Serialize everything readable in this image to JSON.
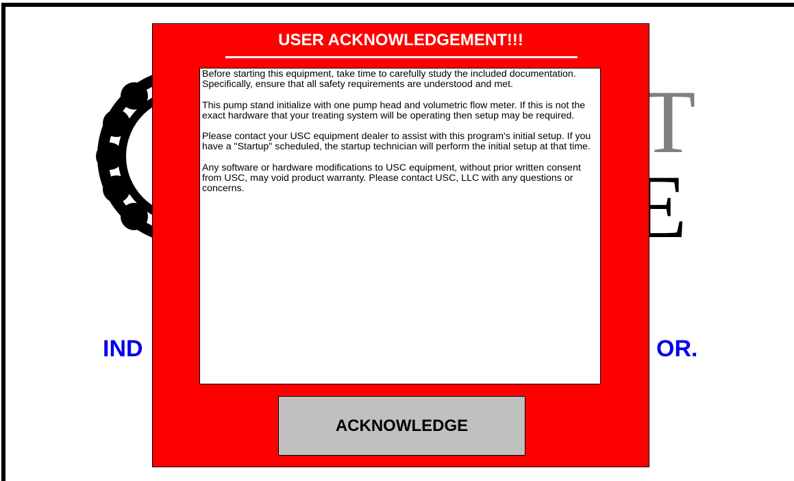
{
  "background": {
    "logo_letter_top": "T",
    "logo_letter_bottom": "E",
    "tagline_left": "IND",
    "tagline_right": "OR.",
    "tagline_color": "#0000ee",
    "gear_icon": "gear-icon"
  },
  "dialog": {
    "title": "USER ACKNOWLEDGEMENT!!!",
    "background_color": "#ff0000",
    "paragraphs": [
      "Before starting this equipment, take time to carefully study the included documentation.  Specifically, ensure that all safety requirements are understood and met.",
      "This pump stand initialize with one pump head and volumetric flow meter.  If this is not the exact hardware that your treating system will be operating then setup may be required.",
      "Please contact your USC equipment dealer to assist with this program's initial setup.  If you have a \"Startup\" scheduled, the startup technician will perform the initial setup at that time.",
      "Any software or hardware modifications to USC equipment, without prior written consent from USC, may void product warranty.  Please contact USC, LLC with any questions or concerns."
    ],
    "acknowledge_label": "ACKNOWLEDGE"
  }
}
